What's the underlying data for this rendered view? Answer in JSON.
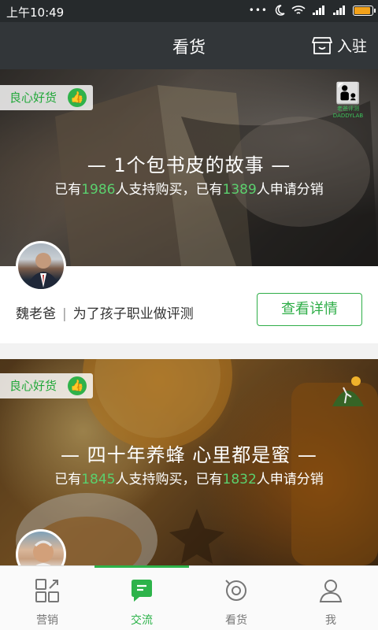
{
  "status_bar": {
    "time": "上午10:49",
    "dots": "•••"
  },
  "header": {
    "title": "看货",
    "enter_label": "入驻"
  },
  "cards": [
    {
      "tag": "良心好货",
      "brand_text": "老爸评测",
      "brand_sub": "DADDYLAB",
      "headline": "— 1个包书皮的故事 —",
      "stats": {
        "prefix": "已有",
        "buyers": "1986",
        "mid": "人支持购买，已有",
        "sellers": "1389",
        "suffix": "人申请分销"
      },
      "author": "魏老爸",
      "author_desc": "为了孩子职业做评测",
      "detail_label": "查看详情"
    },
    {
      "tag": "良心好货",
      "brand_text": "",
      "brand_sub": "",
      "headline": "— 四十年养蜂 心里都是蜜 —",
      "stats": {
        "prefix": "已有",
        "buyers": "1845",
        "mid": "人支持购买，已有",
        "sellers": "1832",
        "suffix": "人申请分销"
      }
    }
  ],
  "tabs": [
    {
      "label": "营销",
      "icon": "grid-icon"
    },
    {
      "label": "交流",
      "icon": "chat-icon",
      "active": true
    },
    {
      "label": "看货",
      "icon": "magnifier-icon"
    },
    {
      "label": "我",
      "icon": "user-icon"
    }
  ],
  "colors": {
    "accent": "#2db34a",
    "header": "#323639",
    "statusbar": "#262a2c",
    "battery": "#f3a21a"
  }
}
